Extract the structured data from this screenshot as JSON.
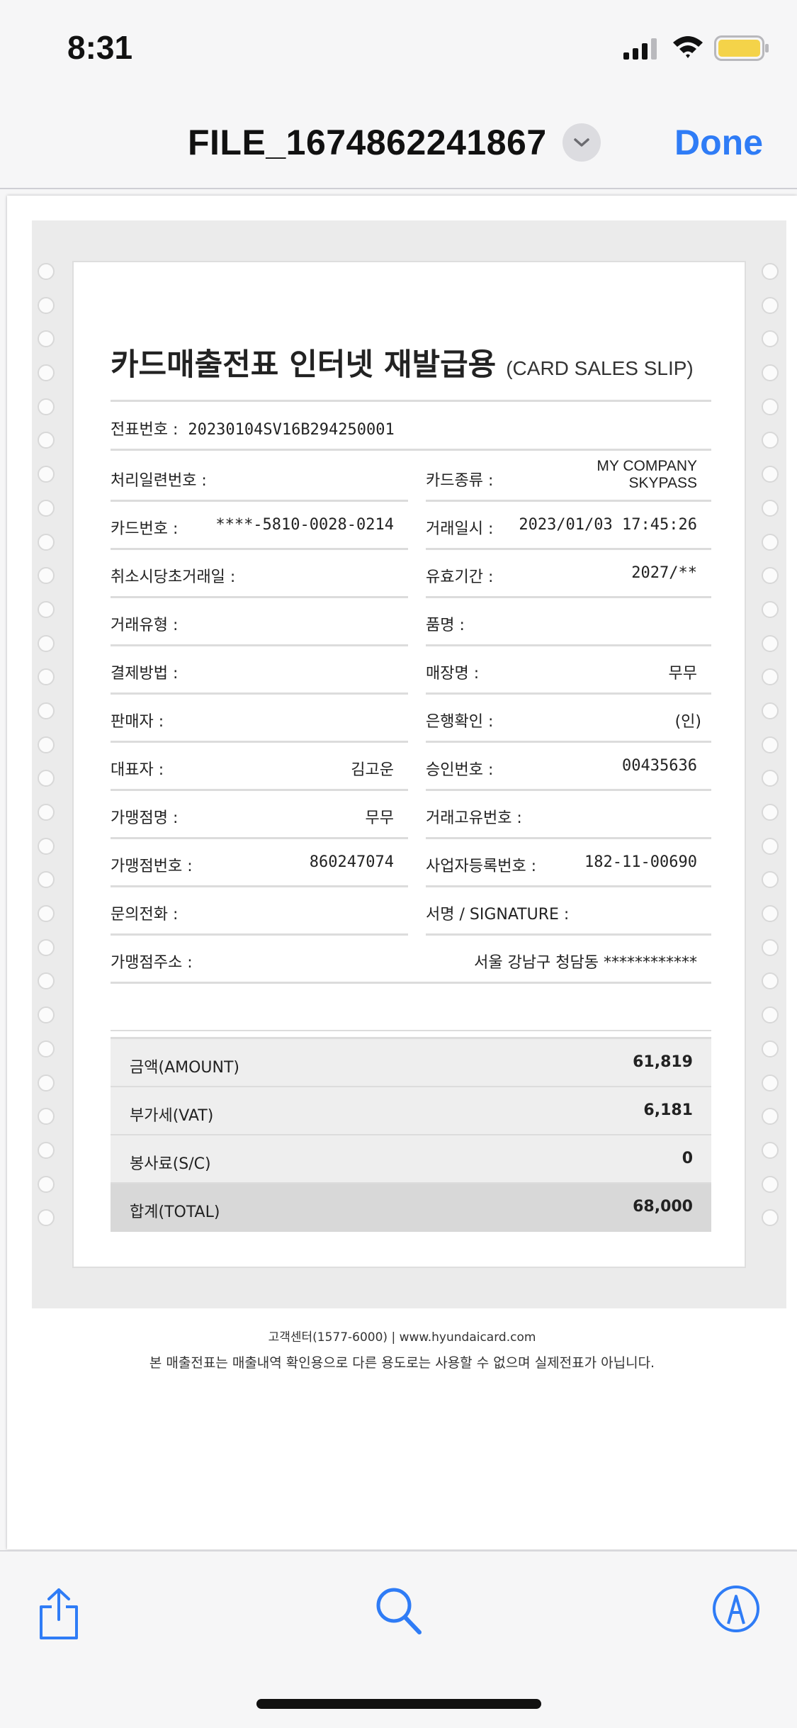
{
  "status_bar": {
    "time": "8:31"
  },
  "header": {
    "file_title": "FILE_1674862241867",
    "done_label": "Done"
  },
  "slip": {
    "title_ko": "카드매출전표 인터넷 재발급용",
    "title_en": "(CARD SALES SLIP)",
    "slip_no_label": "전표번호 :",
    "slip_no_value": "20230104SV16B294250001",
    "left_fields": [
      {
        "label": "처리일련번호 :",
        "value": ""
      },
      {
        "label": "카드번호 :",
        "value": "****-5810-0028-0214"
      },
      {
        "label": "취소시당초거래일 :",
        "value": ""
      },
      {
        "label": "거래유형 :",
        "value": ""
      },
      {
        "label": "결제방법 :",
        "value": ""
      },
      {
        "label": "판매자 :",
        "value": ""
      },
      {
        "label": "대표자 :",
        "value": "김고운"
      },
      {
        "label": "가맹점명 :",
        "value": "무무"
      },
      {
        "label": "가맹점번호 :",
        "value": "860247074"
      },
      {
        "label": "문의전화 :",
        "value": ""
      },
      {
        "label": "가맹점주소 :",
        "value": "서울 강남구 청담동 ************"
      }
    ],
    "right_fields": [
      {
        "label": "카드종류 :",
        "value_line1": "MY COMPANY",
        "value_line2": "SKYPASS"
      },
      {
        "label": "거래일시 :",
        "value": "2023/01/03 17:45:26"
      },
      {
        "label": "유효기간 :",
        "value": "2027/**"
      },
      {
        "label": "품명 :",
        "value": ""
      },
      {
        "label": "매장명 :",
        "value": "무무"
      },
      {
        "label": "은행확인 :",
        "value": "(인)"
      },
      {
        "label": "승인번호 :",
        "value": "00435636"
      },
      {
        "label": "거래고유번호 :",
        "value": ""
      },
      {
        "label": "사업자등록번호 :",
        "value": "182-11-00690"
      },
      {
        "label": "서명 / SIGNATURE :",
        "value": ""
      }
    ],
    "totals": [
      {
        "label": "금액(AMOUNT)",
        "value": "61,819"
      },
      {
        "label": "부가세(VAT)",
        "value": "6,181"
      },
      {
        "label": "봉사료(S/C)",
        "value": "0"
      },
      {
        "label": "합계(TOTAL)",
        "value": "68,000"
      }
    ]
  },
  "footer": {
    "contact": "고객센터(1577-6000)  |  www.hyundaicard.com",
    "notice": "본 매출전표는 매출내역 확인용으로 다른 용도로는 사용할 수 없으며 실제전표가 아닙니다."
  },
  "toolbar": {
    "icons": [
      "share-icon",
      "search-icon",
      "markup-icon"
    ]
  },
  "colors": {
    "accent": "#2f7cf6",
    "battery": "#f4d349"
  }
}
